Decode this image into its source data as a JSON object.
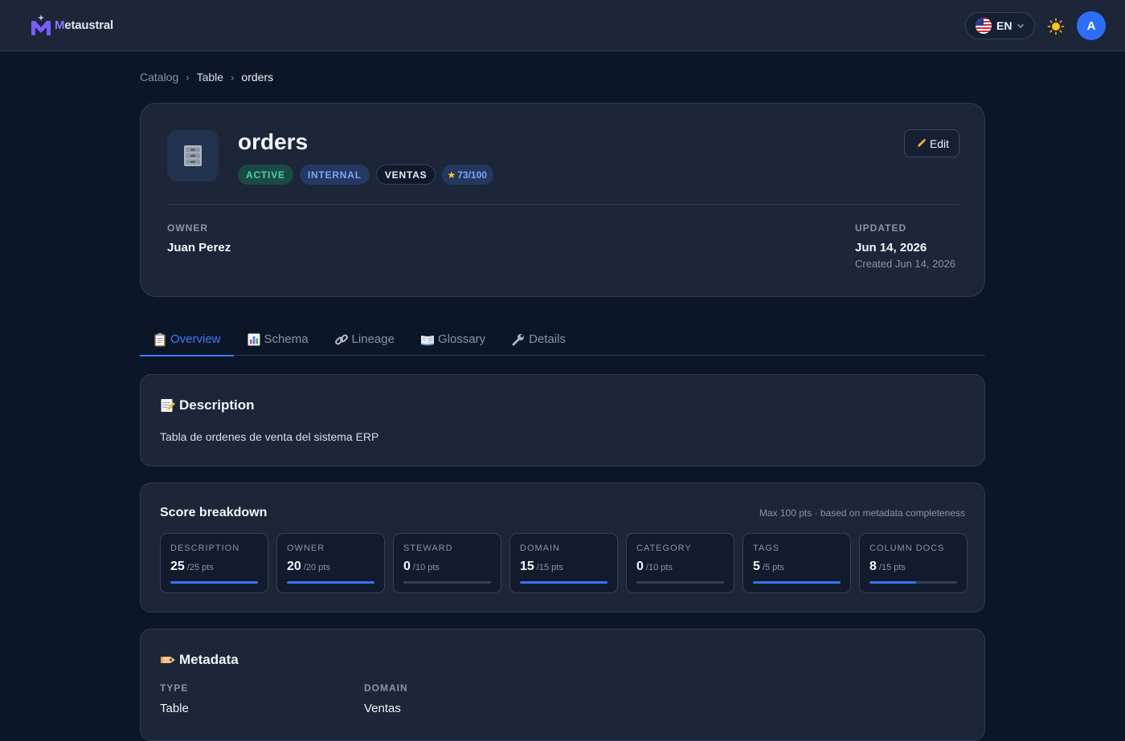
{
  "brand": {
    "first_letter": "M",
    "rest": "etaustral"
  },
  "header": {
    "language_code": "EN",
    "avatar_initial": "A"
  },
  "breadcrumb": {
    "items": [
      "Catalog",
      "Table",
      "orders"
    ]
  },
  "asset": {
    "name": "orders",
    "badges": {
      "status": "ACTIVE",
      "visibility": "INTERNAL",
      "domain": "VENTAS",
      "score": "73/100"
    },
    "edit_label": "Edit",
    "owner_label": "OWNER",
    "owner": "Juan Perez",
    "updated_label": "UPDATED",
    "updated": "Jun 14, 2026",
    "created": "Created Jun 14, 2026"
  },
  "tabs": [
    {
      "label": "Overview",
      "icon": "clipboard-icon",
      "active": true
    },
    {
      "label": "Schema",
      "icon": "bar-chart-icon",
      "active": false
    },
    {
      "label": "Lineage",
      "icon": "link-icon",
      "active": false
    },
    {
      "label": "Glossary",
      "icon": "book-icon",
      "active": false
    },
    {
      "label": "Details",
      "icon": "wrench-icon",
      "active": false
    }
  ],
  "description": {
    "title": "Description",
    "text": "Tabla de ordenes de venta del sistema ERP"
  },
  "score_breakdown": {
    "title": "Score breakdown",
    "note": "Max 100 pts · based on metadata completeness",
    "items": [
      {
        "label": "DESCRIPTION",
        "value": "25",
        "max": "/25 pts",
        "fraction": 1.0
      },
      {
        "label": "OWNER",
        "value": "20",
        "max": "/20 pts",
        "fraction": 1.0
      },
      {
        "label": "STEWARD",
        "value": "0",
        "max": "/10 pts",
        "fraction": 0.0
      },
      {
        "label": "DOMAIN",
        "value": "15",
        "max": "/15 pts",
        "fraction": 1.0
      },
      {
        "label": "CATEGORY",
        "value": "0",
        "max": "/10 pts",
        "fraction": 0.0
      },
      {
        "label": "TAGS",
        "value": "5",
        "max": "/5 pts",
        "fraction": 1.0
      },
      {
        "label": "COLUMN DOCS",
        "value": "8",
        "max": "/15 pts",
        "fraction": 0.53
      }
    ]
  },
  "metadata": {
    "title": "Metadata",
    "fields": [
      {
        "label": "TYPE",
        "value": "Table"
      },
      {
        "label": "DOMAIN",
        "value": "Ventas"
      }
    ]
  },
  "colors": {
    "accent": "#3f7bf5",
    "active_badge": "#4fd3a2",
    "background": "#0c1629",
    "card": "#1c2638"
  }
}
